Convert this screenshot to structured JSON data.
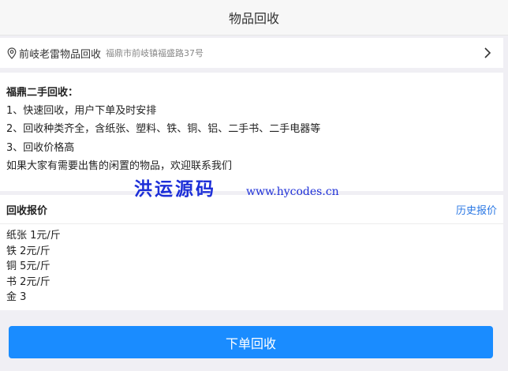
{
  "header": {
    "title": "物品回收"
  },
  "address": {
    "name": "前岐老雷物品回收",
    "detail": "福鼎市前岐镇福盛路37号"
  },
  "info": {
    "title": "福鼎二手回收：",
    "lines": [
      "1、快速回收，用户下单及时安排",
      "2、回收种类齐全，含纸张、塑料、铁、铜、铝、二手书、二手电器等",
      "3、回收价格高",
      "如果大家有需要出售的闲置的物品，欢迎联系我们"
    ]
  },
  "watermark": {
    "main": "洪运源码",
    "url": "www.hycodes.cn"
  },
  "prices": {
    "title": "回收报价",
    "history_label": "历史报价",
    "items": [
      "纸张 1元/斤",
      "铁 2元/斤",
      "铜 5元/斤",
      "书 2元/斤",
      "金 3"
    ]
  },
  "action": {
    "submit_label": "下单回收"
  },
  "colors": {
    "accent": "#1a8cff",
    "link": "#2b78e4",
    "watermark": "#1d2fd8"
  }
}
